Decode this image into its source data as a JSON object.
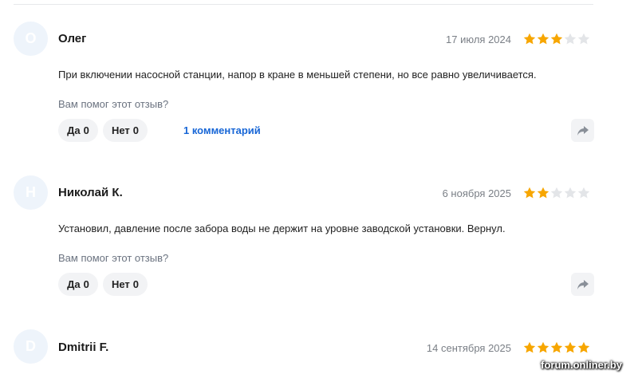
{
  "reviews": [
    {
      "avatar_letter": "О",
      "author": "Олег",
      "date": "17 июля 2024",
      "rating": 3,
      "max_rating": 5,
      "text": "При включении насосной станции, напор в кране в меньшей степени, но все равно увеличивается.",
      "helpful_question": "Вам помог этот отзыв?",
      "yes_label": "Да",
      "yes_count": "0",
      "no_label": "Нет",
      "no_count": "0",
      "comments_link": "1 комментарий"
    },
    {
      "avatar_letter": "Н",
      "author": "Николай К.",
      "date": "6 ноября 2025",
      "rating": 2,
      "max_rating": 5,
      "text": "Установил, давление после забора воды не держит на уровне заводской установки. Вернул.",
      "helpful_question": "Вам помог этот отзыв?",
      "yes_label": "Да",
      "yes_count": "0",
      "no_label": "Нет",
      "no_count": "0"
    },
    {
      "avatar_letter": "D",
      "author": "Dmitrii F.",
      "date": "14 сентября 2025",
      "rating": 5,
      "max_rating": 5
    }
  ],
  "colors": {
    "star_filled": "#f7a600",
    "star_empty": "#e3e5e8",
    "link": "#1766d6",
    "avatar_bg": "#eef4fb"
  },
  "icons": {
    "share": "share-arrow-icon",
    "star": "star-icon"
  },
  "watermark": "forum.onliner.by"
}
